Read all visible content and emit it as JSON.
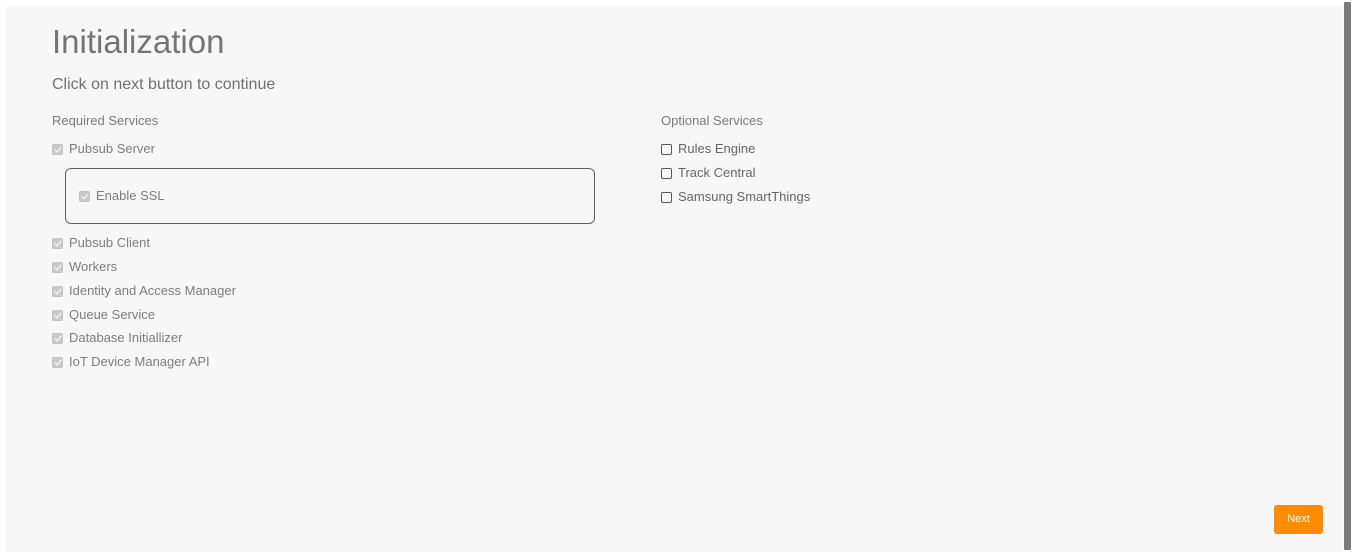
{
  "page": {
    "title": "Initialization",
    "subtitle": "Click on next button to continue"
  },
  "required": {
    "heading": "Required Services",
    "pubsub_server": {
      "label": "Pubsub Server",
      "checked": true,
      "disabled": true
    },
    "enable_ssl": {
      "label": "Enable SSL",
      "checked": true,
      "disabled": true
    },
    "items": [
      {
        "label": "Pubsub Client",
        "checked": true,
        "disabled": true
      },
      {
        "label": "Workers",
        "checked": true,
        "disabled": true
      },
      {
        "label": "Identity and Access Manager",
        "checked": true,
        "disabled": true
      },
      {
        "label": "Queue Service",
        "checked": true,
        "disabled": true
      },
      {
        "label": "Database Initiallizer",
        "checked": true,
        "disabled": true
      },
      {
        "label": "IoT Device Manager API",
        "checked": true,
        "disabled": true
      }
    ]
  },
  "optional": {
    "heading": "Optional Services",
    "items": [
      {
        "label": "Rules Engine",
        "checked": false,
        "disabled": false
      },
      {
        "label": "Track Central",
        "checked": false,
        "disabled": false
      },
      {
        "label": "Samsung SmartThings",
        "checked": false,
        "disabled": false
      }
    ]
  },
  "actions": {
    "next_label": "Next"
  },
  "colors": {
    "accent": "#ff8c00",
    "background": "#f7f7f7"
  }
}
